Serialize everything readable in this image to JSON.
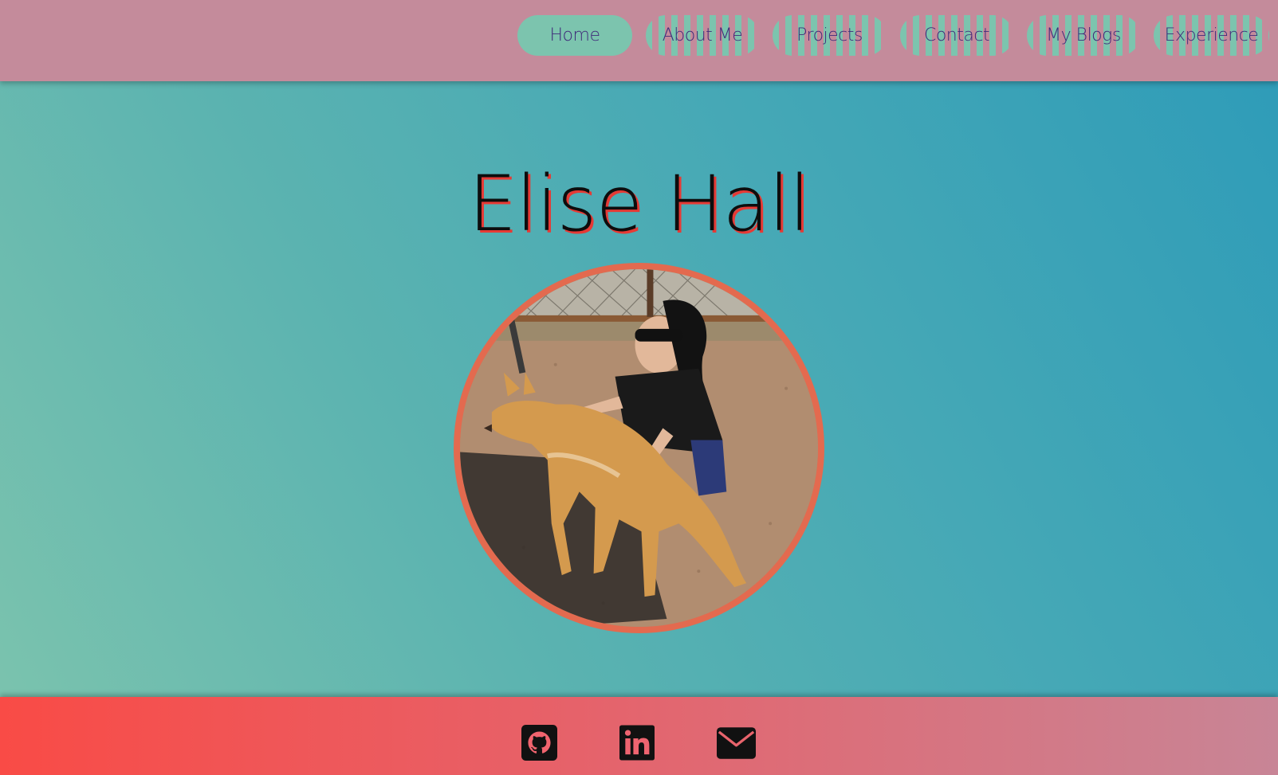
{
  "nav": {
    "items": [
      {
        "label": "Home",
        "active": true
      },
      {
        "label": "About Me",
        "active": false
      },
      {
        "label": "Projects",
        "active": false
      },
      {
        "label": "Contact",
        "active": false
      },
      {
        "label": "My Blogs",
        "active": false
      },
      {
        "label": "Experience",
        "active": false
      }
    ]
  },
  "hero": {
    "name": "Elise Hall",
    "photo_alt": "Photo of a person kneeling next to a dingo"
  },
  "footer": {
    "links": [
      {
        "icon": "github-icon",
        "label": "GitHub"
      },
      {
        "icon": "linkedin-icon",
        "label": "LinkedIn"
      },
      {
        "icon": "mail-icon",
        "label": "Email"
      }
    ]
  },
  "colors": {
    "header_bg": "#c48b9b",
    "nav_active_bg": "#7cc4ae",
    "nav_text": "#3f2b7a",
    "title_text": "#0d0d0d",
    "title_shadow": "#e63a35",
    "portrait_border": "#e36a4f",
    "footer_gradient_start": "#f94b46",
    "footer_gradient_end": "#c88596"
  }
}
